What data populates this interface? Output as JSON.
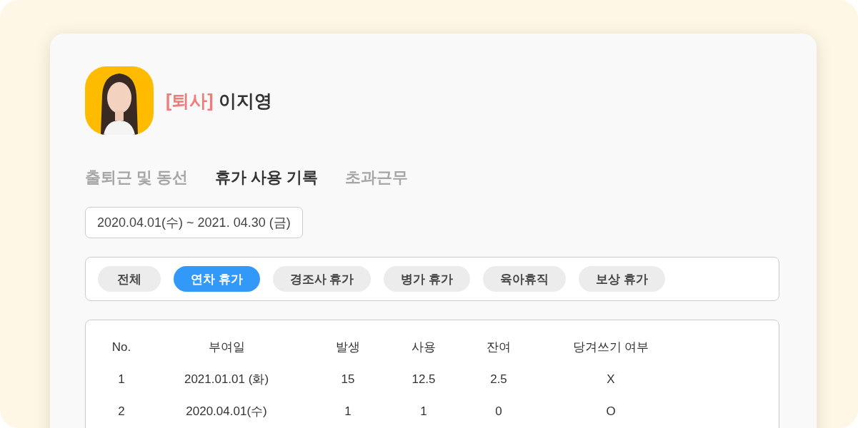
{
  "profile": {
    "status": "[퇴사]",
    "name": "이지영"
  },
  "tabs": [
    {
      "label": "출퇴근 및 동선",
      "selected": false
    },
    {
      "label": "휴가 사용 기록",
      "selected": true
    },
    {
      "label": "초과근무",
      "selected": false
    }
  ],
  "date_range": "2020.04.01(수) ~ 2021. 04.30 (금)",
  "filters": [
    {
      "label": "전체",
      "selected": false
    },
    {
      "label": "연차 휴가",
      "selected": true
    },
    {
      "label": "경조사 휴가",
      "selected": false
    },
    {
      "label": "병가 휴가",
      "selected": false
    },
    {
      "label": "육아휴직",
      "selected": false
    },
    {
      "label": "보상 휴가",
      "selected": false
    }
  ],
  "table": {
    "columns": [
      "No.",
      "부여일",
      "발생",
      "사용",
      "잔여",
      "당겨쓰기 여부"
    ],
    "rows": [
      [
        "1",
        "2021.01.01 (화)",
        "15",
        "12.5",
        "2.5",
        "X"
      ],
      [
        "2",
        "2020.04.01(수)",
        "1",
        "1",
        "0",
        "O"
      ]
    ]
  }
}
